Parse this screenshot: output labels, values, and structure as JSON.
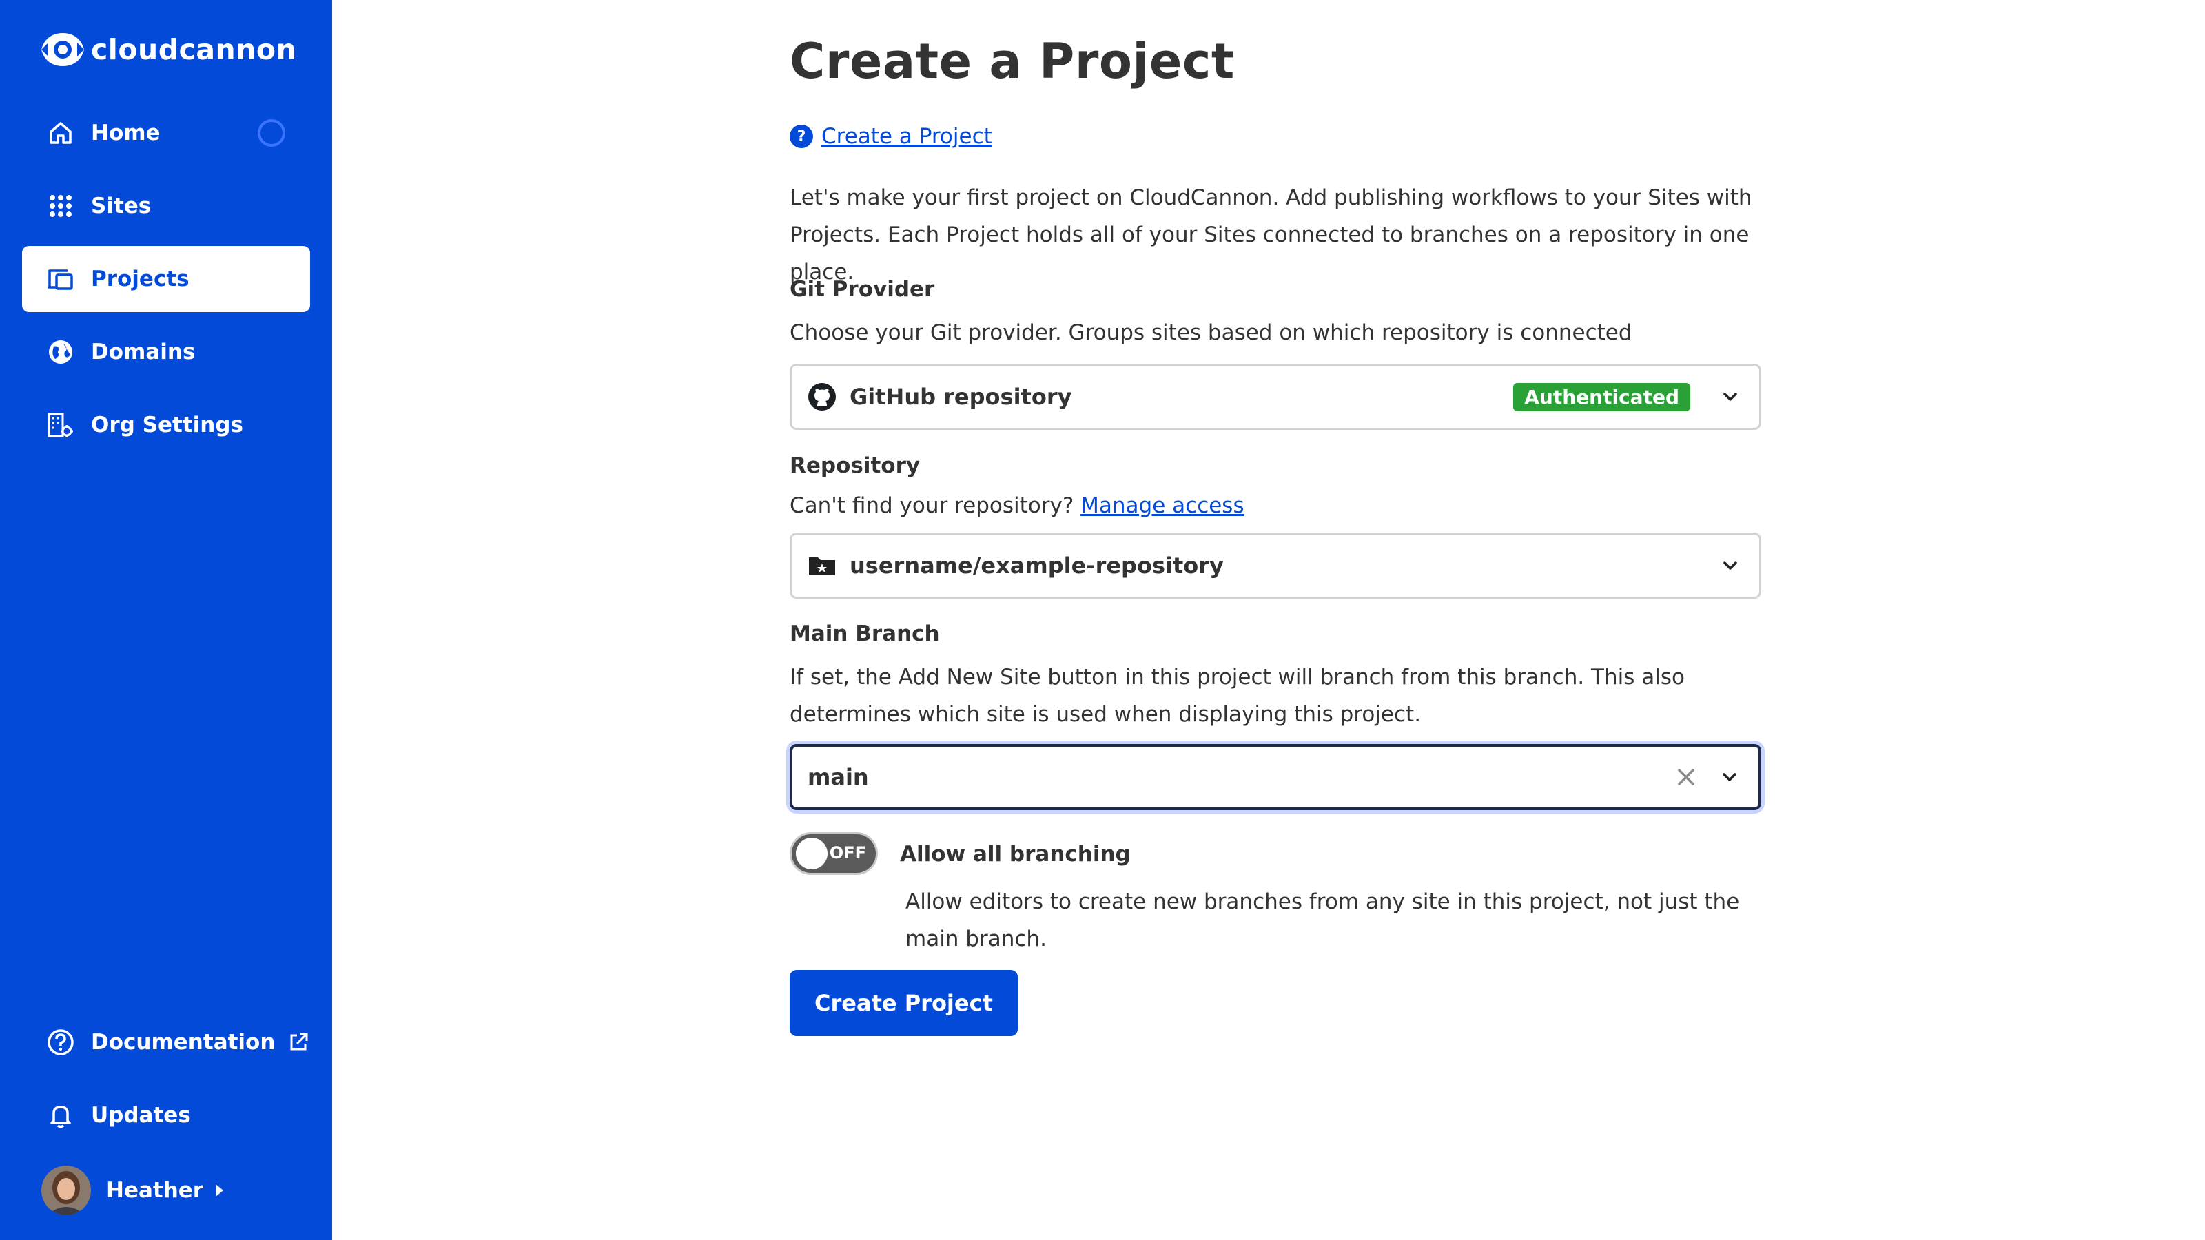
{
  "sidebar": {
    "brand": "cloudcannon",
    "nav": [
      {
        "label": "Home",
        "icon": "home-icon"
      },
      {
        "label": "Sites",
        "icon": "grid-icon"
      },
      {
        "label": "Projects",
        "icon": "projects-icon",
        "active": true
      },
      {
        "label": "Domains",
        "icon": "globe-icon"
      },
      {
        "label": "Org Settings",
        "icon": "org-settings-icon"
      }
    ],
    "bottom": [
      {
        "label": "Documentation",
        "icon": "help-circle-icon"
      },
      {
        "label": "Updates",
        "icon": "bell-icon"
      }
    ],
    "user": {
      "name": "Heather"
    }
  },
  "main": {
    "title": "Create a Project",
    "help_link": "Create a Project",
    "intro": "Let's make your first project on CloudCannon. Add publishing workflows to your Sites with Projects. Each Project holds all of your Sites connected to branches on a repository in one place.",
    "git_provider": {
      "heading": "Git Provider",
      "description": "Choose your Git provider. Groups sites based on which repository is connected",
      "value": "GitHub repository",
      "badge": "Authenticated"
    },
    "repository": {
      "heading": "Repository",
      "hint": "Can't find your repository?",
      "hint_link": "Manage access",
      "value": "username/example-repository"
    },
    "main_branch": {
      "heading": "Main Branch",
      "description": "If set, the Add New Site button in this project will branch from this branch. This also determines which site is used when displaying this project.",
      "value": "main"
    },
    "allow_branching": {
      "toggle_state": "OFF",
      "label": "Allow all branching",
      "description": "Allow editors to create new branches from any site in this project, not just the main branch."
    },
    "submit_label": "Create Project"
  },
  "colors": {
    "brand": "#034ad8",
    "badge_green": "#2aa137"
  }
}
